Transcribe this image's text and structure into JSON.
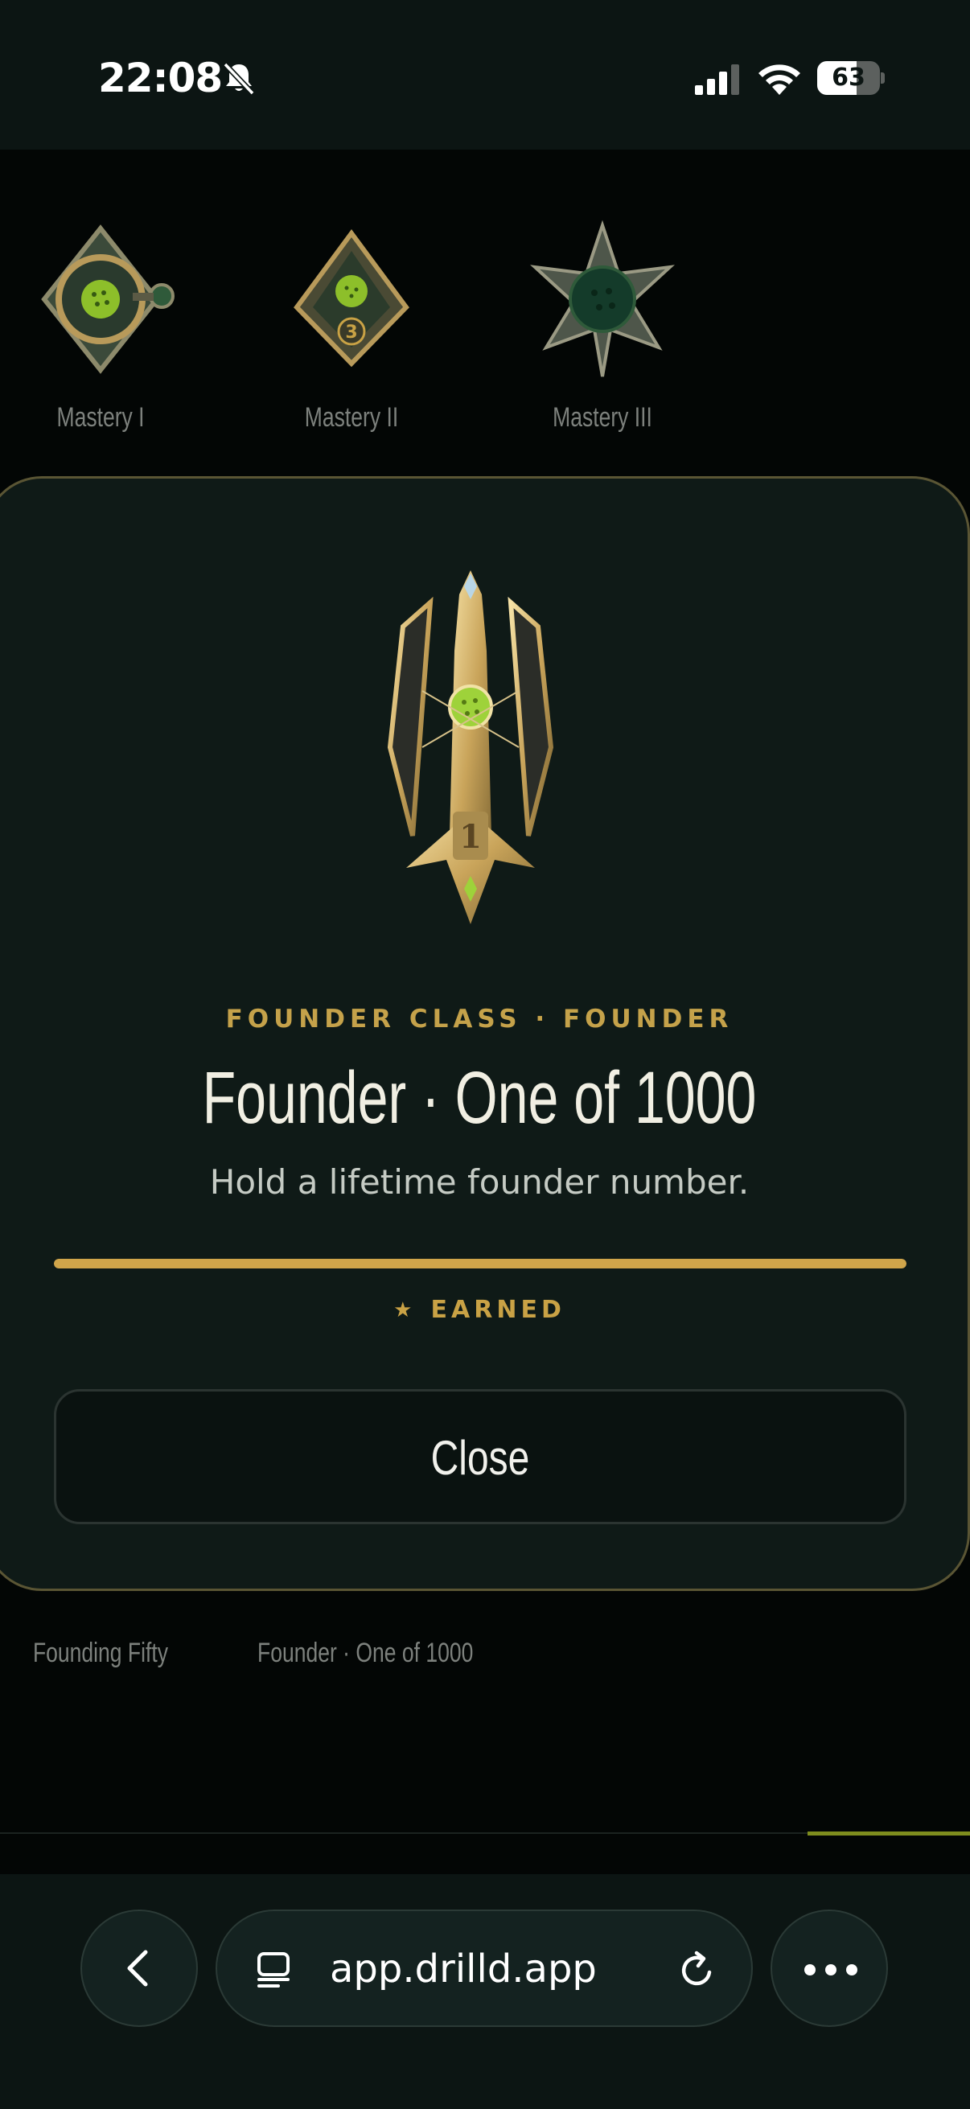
{
  "status_bar": {
    "time": "22:08",
    "battery_level": "63",
    "battery_fraction": 0.63,
    "icons": [
      "bell-slash-icon",
      "cellular-signal-icon",
      "wifi-icon",
      "battery-icon"
    ]
  },
  "background_page": {
    "top_badges": [
      {
        "label": "Mastery I",
        "icon": "mastery-i-badge-icon"
      },
      {
        "label": "Mastery II",
        "icon": "mastery-ii-badge-icon"
      },
      {
        "label": "Mastery III",
        "icon": "mastery-iii-badge-icon"
      }
    ],
    "bottom_badges": [
      {
        "label": "Founding Fifty"
      },
      {
        "label": "Founder · One of 1000"
      }
    ],
    "colors": {
      "accent_line": "#7e8d1e",
      "label": "#7d817d"
    }
  },
  "modal": {
    "medal_icon": "founder-medal-icon",
    "eyebrow": "FOUNDER CLASS  ·  FOUNDER",
    "title": "Founder · One of 1000",
    "description": "Hold a lifetime founder number.",
    "progress_fraction": 1.0,
    "status_icon": "star-icon",
    "status": "EARNED",
    "close_label": "Close",
    "colors": {
      "gold": "#c9a245",
      "panel": "#0f1a17",
      "progress": "#d0a54a"
    }
  },
  "browser": {
    "url": "app.drilld.app",
    "icons": [
      "back-chevron-icon",
      "reader-mode-icon",
      "reload-icon",
      "more-icon"
    ]
  }
}
